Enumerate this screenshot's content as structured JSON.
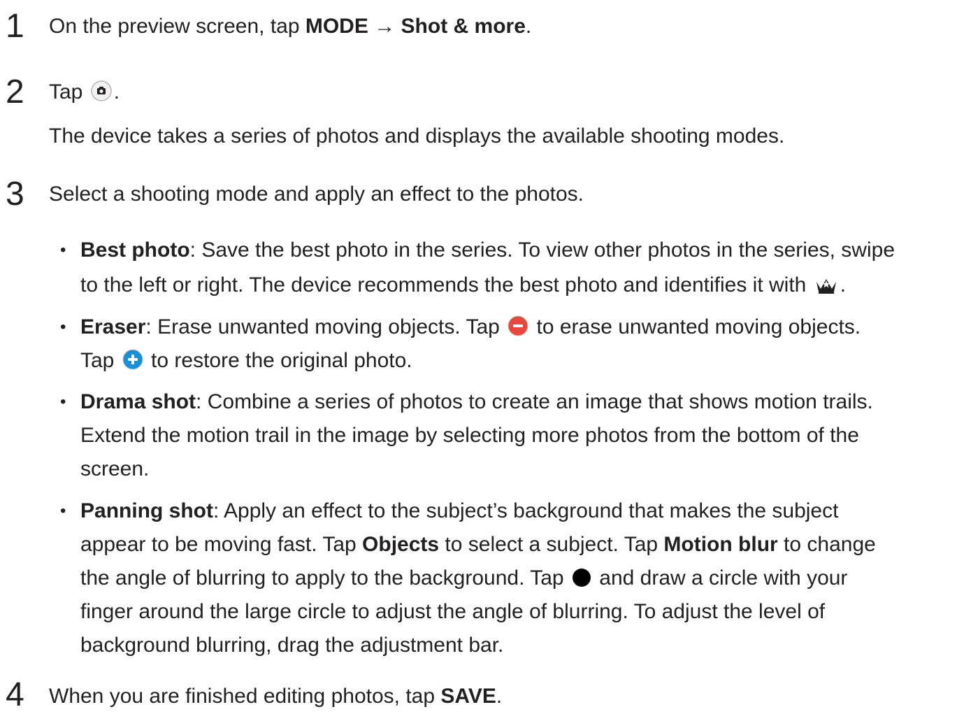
{
  "steps": [
    {
      "number": "1",
      "text_prefix": "On the preview screen, tap ",
      "bold_mode": "MODE",
      "arrow": " → ",
      "bold_target": "Shot & more",
      "text_suffix": "."
    },
    {
      "number": "2",
      "text_prefix": "Tap ",
      "icon": "camera-shutter-icon",
      "text_suffix": ".",
      "description": "The device takes a series of photos and displays the available shooting modes."
    },
    {
      "number": "3",
      "text": "Select a shooting mode and apply an effect to the photos."
    },
    {
      "number": "4",
      "text_prefix": "When you are finished editing photos, tap ",
      "bold_target": "SAVE",
      "text_suffix": "."
    }
  ],
  "bullets": {
    "marker": "•",
    "best_photo": {
      "title": "Best photo",
      "l1": ": Save the best photo in the series. To view other photos in the series, swipe",
      "l2_prefix": "to the left or right. The device recommends the best photo and identifies it with ",
      "l2_icon": "crown-icon",
      "l2_suffix": "."
    },
    "eraser": {
      "title": "Eraser",
      "l1_prefix": ": Erase unwanted moving objects. Tap ",
      "l1_icon": "minus-circle-icon",
      "l1_suffix": " to erase unwanted moving objects.",
      "l2_prefix": "Tap ",
      "l2_icon": "plus-circle-icon",
      "l2_suffix": " to restore the original photo."
    },
    "drama_shot": {
      "title": "Drama shot",
      "l1": ": Combine a series of photos to create an image that shows motion trails.",
      "l2": "Extend the motion trail in the image by selecting more photos from the bottom of the",
      "l3": "screen."
    },
    "panning_shot": {
      "title": "Panning shot",
      "l1": ": Apply an effect to the subject’s background that makes the subject",
      "l2_prefix": "appear to be moving fast. Tap ",
      "l2_bold1": "Objects",
      "l2_mid": " to select a subject. Tap ",
      "l2_bold2": "Motion blur",
      "l2_suffix": " to change",
      "l3_prefix": "the angle of blurring to apply to the background. Tap ",
      "l3_icon": "black-dot-icon",
      "l3_suffix": " and draw a circle with your",
      "l4": "finger around the large circle to adjust the angle of blurring. To adjust the level of",
      "l5": "background blurring, drag the adjustment bar."
    }
  },
  "colors": {
    "text": "#231f20",
    "minus_icon": "#e8473c",
    "plus_icon": "#1a8fd8"
  }
}
